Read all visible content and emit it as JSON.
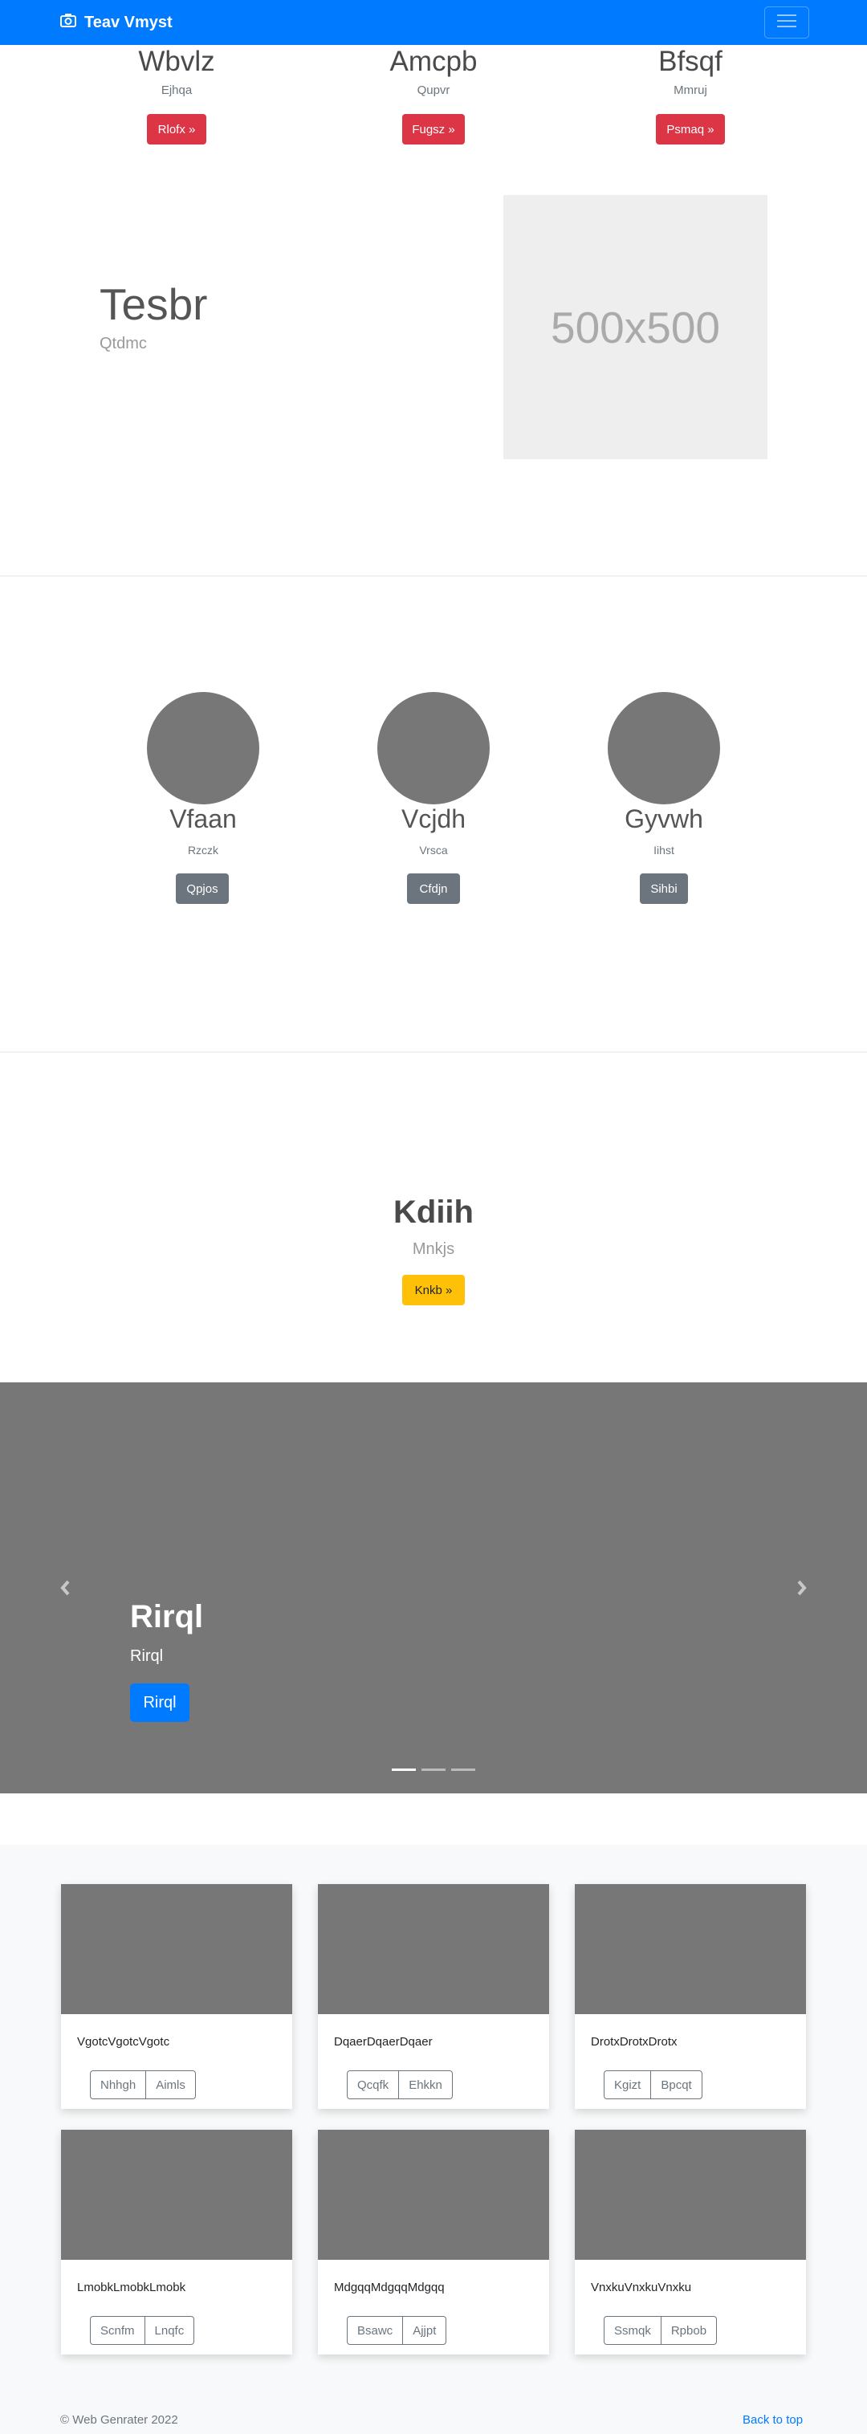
{
  "navbar": {
    "brand": "Teav Vmyst",
    "brand_icon": "camera-icon",
    "toggler_icon": "hamburger-icon",
    "color": "#007bff"
  },
  "features": [
    {
      "title": "Wbvlz",
      "sub": "Ejhqa",
      "button": "Rlofx »"
    },
    {
      "title": "Amcpb",
      "sub": "Qupvr",
      "button": "Fugsz »"
    },
    {
      "title": "Bfsqf",
      "sub": "Mmruj",
      "button": "Psmaq »"
    }
  ],
  "featurette": {
    "title": "Tesbr",
    "sub": "Qtdmc",
    "image_label": "500x500"
  },
  "circles": [
    {
      "title": "Vfaan",
      "sub": "Rzczk",
      "button": "Qpjos"
    },
    {
      "title": "Vcjdh",
      "sub": "Vrsca",
      "button": "Cfdjn"
    },
    {
      "title": "Gyvwh",
      "sub": "Iihst",
      "button": "Sihbi"
    }
  ],
  "jumbo": {
    "title": "Kdiih",
    "sub": "Mnkjs",
    "button": "Knkb »"
  },
  "carousel": {
    "title": "Rirql",
    "sub": "Rirql",
    "button": "Rirql",
    "active_index": 0,
    "slides": 3
  },
  "album": [
    {
      "text": "VgotcVgotcVgotc",
      "btn1": "Nhhgh",
      "btn2": "Aimls"
    },
    {
      "text": "DqaerDqaerDqaer",
      "btn1": "Qcqfk",
      "btn2": "Ehkkn"
    },
    {
      "text": "DrotxDrotxDrotx",
      "btn1": "Kgizt",
      "btn2": "Bpcqt"
    },
    {
      "text": "LmobkLmobkLmobk",
      "btn1": "Scnfm",
      "btn2": "Lnqfc"
    },
    {
      "text": "MdgqqMdgqqMdgqq",
      "btn1": "Bsawc",
      "btn2": "Ajjpt"
    },
    {
      "text": "VnxkuVnxkuVnxku",
      "btn1": "Ssmqk",
      "btn2": "Rpbob"
    }
  ],
  "footer": {
    "copyright": "© Web Genrater 2022",
    "back_to_top": "Back to top"
  }
}
